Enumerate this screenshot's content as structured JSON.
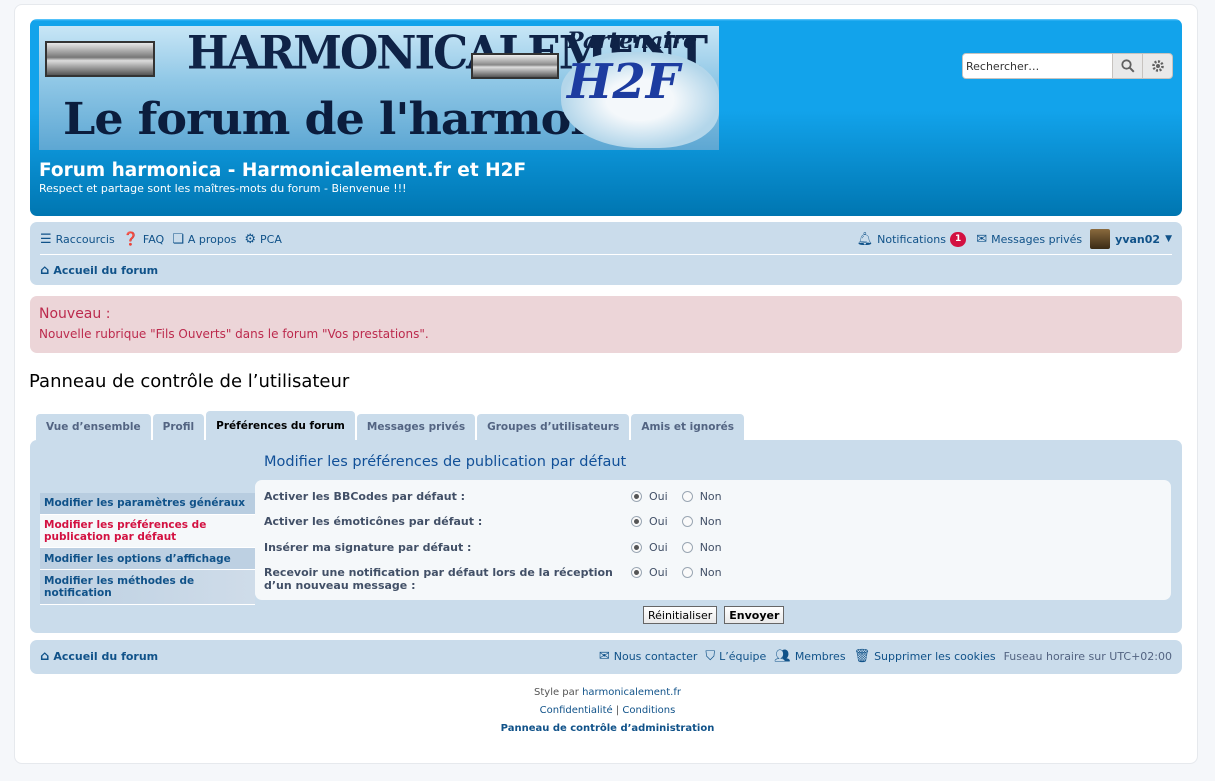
{
  "header": {
    "banner_line1": "HARMONICALEMENT",
    "banner_line2": "Le forum de l'harmonica",
    "banner_partner": "Partenaire",
    "banner_logo": "H2F",
    "site_title": "Forum harmonica - Harmonicalement.fr et H2F",
    "site_desc": "Respect et partage sont les maîtres-mots du forum - Bienvenue !!!",
    "search_placeholder": "Rechercher…"
  },
  "navbar": {
    "links": [
      "Raccourcis",
      "FAQ",
      "A propos",
      "PCA"
    ],
    "notifications_label": "Notifications",
    "notifications_count": "1",
    "messages_label": "Messages privés",
    "username": "yvan02",
    "breadcrumb": "Accueil du forum"
  },
  "notice": {
    "title": "Nouveau :",
    "message": "Nouvelle rubrique \"Fils Ouverts\" dans le forum \"Vos prestations\"."
  },
  "page_title": "Panneau de contrôle de l’utilisateur",
  "tabs": [
    "Vue d’ensemble",
    "Profil",
    "Préférences du forum",
    "Messages privés",
    "Groupes d’utilisateurs",
    "Amis et ignorés"
  ],
  "sidemenu": [
    "Modifier les paramètres généraux",
    "Modifier les préférences de publication par défaut",
    "Modifier les options d’affichage",
    "Modifier les méthodes de notification"
  ],
  "form": {
    "title": "Modifier les préférences de publication par défaut",
    "yes": "Oui",
    "no": "Non",
    "rows": [
      "Activer les BBCodes par défaut :",
      "Activer les émoticônes par défaut :",
      "Insérer ma signature par défaut :",
      "Recevoir une notification par défaut lors de la réception d’un nouveau message :"
    ],
    "reset_label": "Réinitialiser",
    "submit_label": "Envoyer"
  },
  "footer": {
    "home": "Accueil du forum",
    "contact": "Nous contacter",
    "team": "L’équipe",
    "members": "Membres",
    "cookies": "Supprimer les cookies",
    "timezone_prefix": "Fuseau horaire sur ",
    "timezone": "UTC+02:00",
    "style_by": "Style par ",
    "style_link": "harmonicalement.fr",
    "privacy": "Confidentialité",
    "terms": "Conditions",
    "acp": "Panneau de contrôle d’administration"
  }
}
